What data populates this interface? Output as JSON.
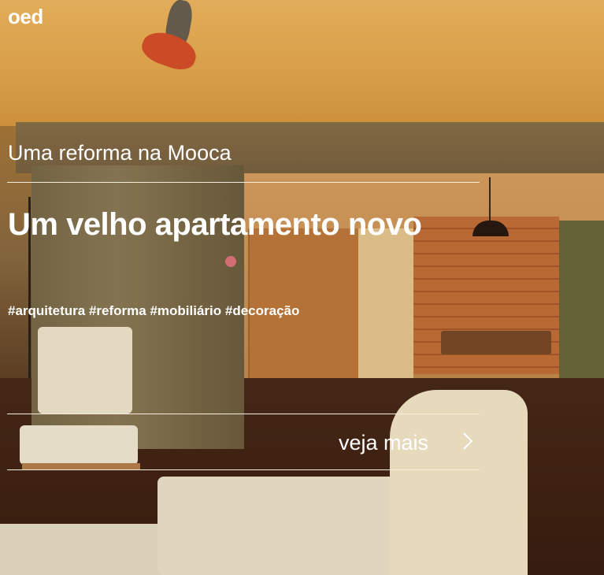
{
  "brand": {
    "logo": "oed"
  },
  "hero": {
    "subtitle": "Uma reforma na Mooca",
    "headline": "Um velho apartamento novo",
    "tags": "#arquitetura #reforma #mobiliário #decoração",
    "cta_label": "veja mais",
    "cta_icon": "chevron-right-icon"
  },
  "colors": {
    "text": "#ffffff",
    "rule": "#f4ede0",
    "accent_warm": "#e6a84c"
  }
}
